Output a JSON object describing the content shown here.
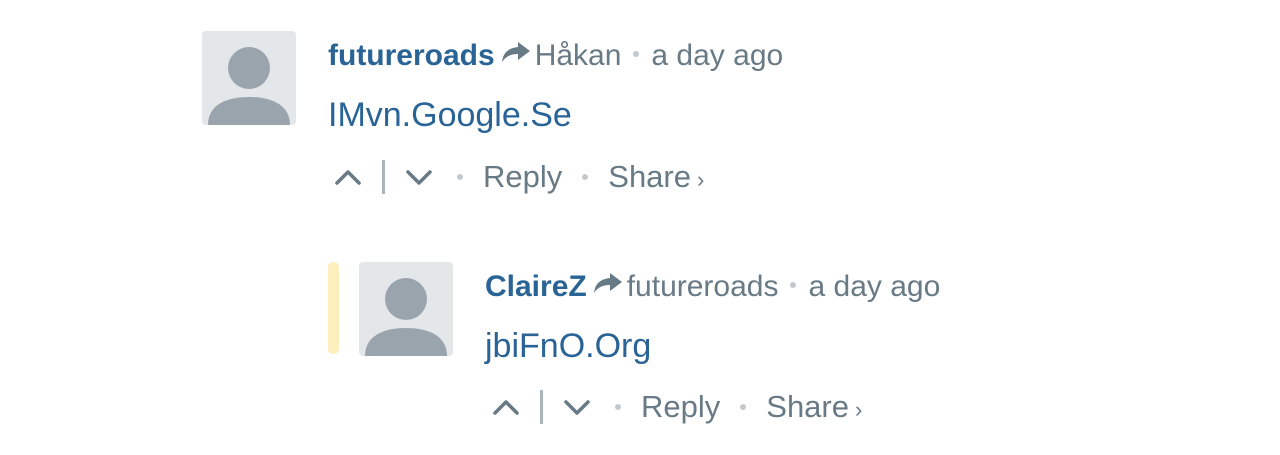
{
  "comments": [
    {
      "author": "futureroads",
      "reply_to": "Håkan",
      "time": "a day ago",
      "body": "IMvn.Google.Se",
      "reply_label": "Reply",
      "share_label": "Share",
      "share_caret": "›"
    },
    {
      "author": "ClaireZ",
      "reply_to": "futureroads",
      "time": "a day ago",
      "body": "jbiFnO.Org",
      "reply_label": "Reply",
      "share_label": "Share",
      "share_caret": "›"
    }
  ],
  "icons": {
    "avatar": "default-avatar-icon",
    "reply_arrow": "reply-arrow-icon",
    "upvote": "chevron-up-icon",
    "downvote": "chevron-down-icon"
  },
  "colors": {
    "link": "#2a6496",
    "meta": "#687a86",
    "avatar_bg": "#e4e7ea",
    "avatar_fg": "#9aa4ad",
    "highlight": "#fbefbd"
  }
}
